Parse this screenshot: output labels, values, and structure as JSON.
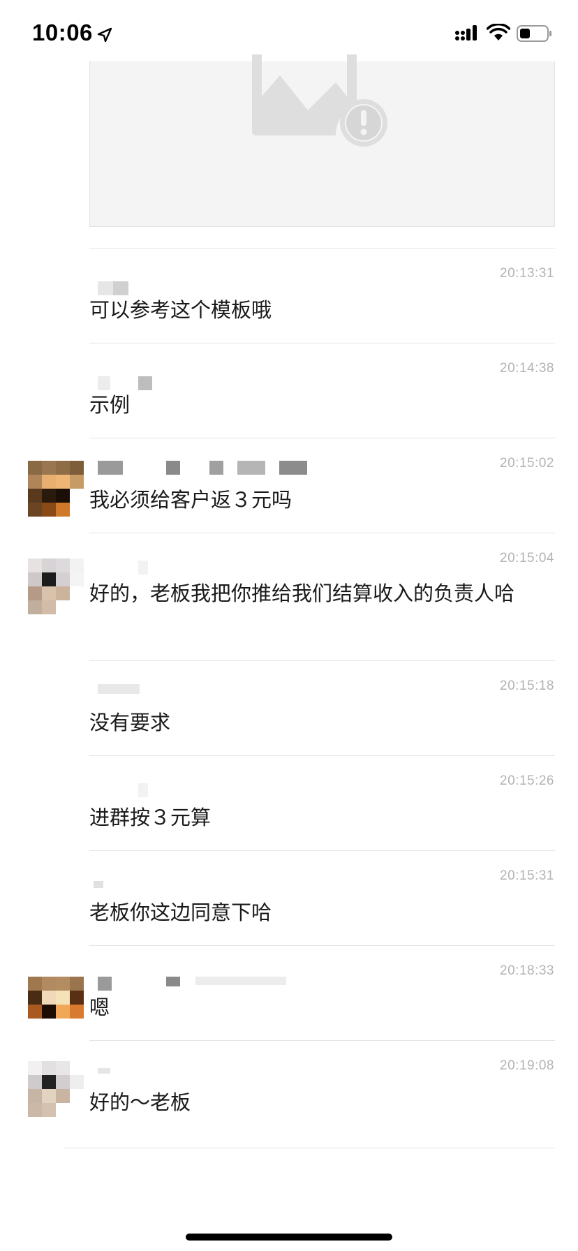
{
  "status_bar": {
    "time": "10:06",
    "icons": [
      "location-arrow-icon",
      "cellular-signal-icon",
      "wifi-icon",
      "battery-icon"
    ]
  },
  "attachment": {
    "icon": "broken-image-icon"
  },
  "messages": [
    {
      "time": "20:13:31",
      "text": "可以参考这个模板哦",
      "has_avatar": false
    },
    {
      "time": "20:14:38",
      "text": "示例",
      "has_avatar": false
    },
    {
      "time": "20:15:02",
      "text": "我必须给客户返３元吗",
      "has_avatar": true
    },
    {
      "time": "20:15:04",
      "text": "好的，老板我把你推给我们结算收入的负责人哈",
      "has_avatar": true
    },
    {
      "time": "20:15:18",
      "text": "没有要求",
      "has_avatar": false
    },
    {
      "time": "20:15:26",
      "text": "进群按３元算",
      "has_avatar": false
    },
    {
      "time": "20:15:31",
      "text": "老板你这边同意下哈",
      "has_avatar": false
    },
    {
      "time": "20:18:33",
      "text": "嗯",
      "has_avatar": true
    },
    {
      "time": "20:19:08",
      "text": "好的～老板",
      "has_avatar": true
    }
  ]
}
